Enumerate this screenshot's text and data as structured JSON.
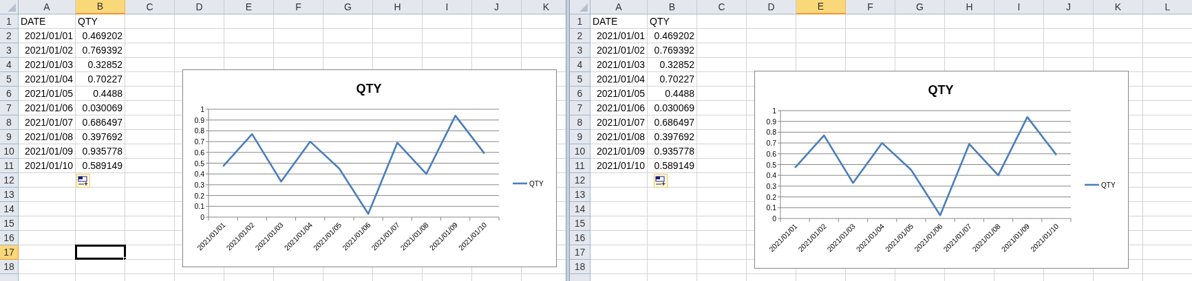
{
  "panes": [
    {
      "columns": [
        {
          "label": "A",
          "selected": false
        },
        {
          "label": "B",
          "selected": true
        },
        {
          "label": "C",
          "selected": false
        },
        {
          "label": "D",
          "selected": false
        },
        {
          "label": "E",
          "selected": false
        },
        {
          "label": "F",
          "selected": false
        },
        {
          "label": "G",
          "selected": false
        },
        {
          "label": "H",
          "selected": false
        },
        {
          "label": "I",
          "selected": false
        },
        {
          "label": "J",
          "selected": false
        },
        {
          "label": "K",
          "selected": false
        }
      ],
      "rows": [
        {
          "label": "1",
          "selected": false,
          "cells": [
            {
              "text": "DATE",
              "kind": "text"
            },
            {
              "text": "QTY",
              "kind": "text"
            }
          ]
        },
        {
          "label": "2",
          "selected": false,
          "cells": [
            {
              "text": "2021/01/01",
              "kind": "number"
            },
            {
              "text": "0.469202",
              "kind": "number"
            }
          ]
        },
        {
          "label": "3",
          "selected": false,
          "cells": [
            {
              "text": "2021/01/02",
              "kind": "number"
            },
            {
              "text": "0.769392",
              "kind": "number"
            }
          ]
        },
        {
          "label": "4",
          "selected": false,
          "cells": [
            {
              "text": "2021/01/03",
              "kind": "number"
            },
            {
              "text": "0.32852",
              "kind": "number"
            }
          ]
        },
        {
          "label": "5",
          "selected": false,
          "cells": [
            {
              "text": "2021/01/04",
              "kind": "number"
            },
            {
              "text": "0.70227",
              "kind": "number"
            }
          ]
        },
        {
          "label": "6",
          "selected": false,
          "cells": [
            {
              "text": "2021/01/05",
              "kind": "number"
            },
            {
              "text": "0.4488",
              "kind": "number"
            }
          ]
        },
        {
          "label": "7",
          "selected": false,
          "cells": [
            {
              "text": "2021/01/06",
              "kind": "number"
            },
            {
              "text": "0.030069",
              "kind": "number"
            }
          ]
        },
        {
          "label": "8",
          "selected": false,
          "cells": [
            {
              "text": "2021/01/07",
              "kind": "number"
            },
            {
              "text": "0.686497",
              "kind": "number"
            }
          ]
        },
        {
          "label": "9",
          "selected": false,
          "cells": [
            {
              "text": "2021/01/08",
              "kind": "number"
            },
            {
              "text": "0.397692",
              "kind": "number"
            }
          ]
        },
        {
          "label": "10",
          "selected": false,
          "cells": [
            {
              "text": "2021/01/09",
              "kind": "number"
            },
            {
              "text": "0.935778",
              "kind": "number"
            }
          ]
        },
        {
          "label": "11",
          "selected": false,
          "cells": [
            {
              "text": "2021/01/10",
              "kind": "number"
            },
            {
              "text": "0.589149",
              "kind": "number"
            }
          ]
        },
        {
          "label": "12",
          "selected": false,
          "cells": []
        },
        {
          "label": "13",
          "selected": false,
          "cells": []
        },
        {
          "label": "14",
          "selected": false,
          "cells": []
        },
        {
          "label": "15",
          "selected": false,
          "cells": []
        },
        {
          "label": "16",
          "selected": false,
          "cells": []
        },
        {
          "label": "17",
          "selected": true,
          "cells": []
        },
        {
          "label": "18",
          "selected": false,
          "cells": []
        }
      ],
      "chart": {
        "chart_data": {
          "type": "line",
          "title": "QTY",
          "categories": [
            "2021/01/01",
            "2021/01/02",
            "2021/01/03",
            "2021/01/04",
            "2021/01/05",
            "2021/01/06",
            "2021/01/07",
            "2021/01/08",
            "2021/01/09",
            "2021/01/10"
          ],
          "series": [
            {
              "name": "QTY",
              "color": "#4a7ebb",
              "values": [
                0.47,
                0.77,
                0.33,
                0.7,
                0.45,
                0.03,
                0.69,
                0.4,
                0.94,
                0.59
              ]
            }
          ],
          "ylim": [
            0,
            1
          ],
          "yticks": [
            0,
            0.1,
            0.2,
            0.3,
            0.4,
            0.5,
            0.6,
            0.7,
            0.8,
            0.9,
            1
          ],
          "grid": true
        }
      }
    },
    {
      "columns": [
        {
          "label": "A",
          "selected": false
        },
        {
          "label": "B",
          "selected": false
        },
        {
          "label": "C",
          "selected": false
        },
        {
          "label": "D",
          "selected": false
        },
        {
          "label": "E",
          "selected": true
        },
        {
          "label": "F",
          "selected": false
        },
        {
          "label": "G",
          "selected": false
        },
        {
          "label": "H",
          "selected": false
        },
        {
          "label": "I",
          "selected": false
        },
        {
          "label": "J",
          "selected": false
        },
        {
          "label": "K",
          "selected": false
        },
        {
          "label": "L",
          "selected": false
        }
      ],
      "rows": [
        {
          "label": "1",
          "selected": false,
          "cells": [
            {
              "text": "DATE",
              "kind": "text"
            },
            {
              "text": "QTY",
              "kind": "text"
            }
          ]
        },
        {
          "label": "2",
          "selected": false,
          "cells": [
            {
              "text": "2021/01/01",
              "kind": "number"
            },
            {
              "text": "0.469202",
              "kind": "number"
            }
          ]
        },
        {
          "label": "3",
          "selected": false,
          "cells": [
            {
              "text": "2021/01/02",
              "kind": "number"
            },
            {
              "text": "0.769392",
              "kind": "number"
            }
          ]
        },
        {
          "label": "4",
          "selected": false,
          "cells": [
            {
              "text": "2021/01/03",
              "kind": "number"
            },
            {
              "text": "0.32852",
              "kind": "number"
            }
          ]
        },
        {
          "label": "5",
          "selected": false,
          "cells": [
            {
              "text": "2021/01/04",
              "kind": "number"
            },
            {
              "text": "0.70227",
              "kind": "number"
            }
          ]
        },
        {
          "label": "6",
          "selected": false,
          "cells": [
            {
              "text": "2021/01/05",
              "kind": "number"
            },
            {
              "text": "0.4488",
              "kind": "number"
            }
          ]
        },
        {
          "label": "7",
          "selected": false,
          "cells": [
            {
              "text": "2021/01/06",
              "kind": "number"
            },
            {
              "text": "0.030069",
              "kind": "number"
            }
          ]
        },
        {
          "label": "8",
          "selected": false,
          "cells": [
            {
              "text": "2021/01/07",
              "kind": "number"
            },
            {
              "text": "0.686497",
              "kind": "number"
            }
          ]
        },
        {
          "label": "9",
          "selected": false,
          "cells": [
            {
              "text": "2021/01/08",
              "kind": "number"
            },
            {
              "text": "0.397692",
              "kind": "number"
            }
          ]
        },
        {
          "label": "10",
          "selected": false,
          "cells": [
            {
              "text": "2021/01/09",
              "kind": "number"
            },
            {
              "text": "0.935778",
              "kind": "number"
            }
          ]
        },
        {
          "label": "11",
          "selected": false,
          "cells": [
            {
              "text": "2021/01/10",
              "kind": "number"
            },
            {
              "text": "0.589149",
              "kind": "number"
            }
          ]
        },
        {
          "label": "12",
          "selected": false,
          "cells": []
        },
        {
          "label": "13",
          "selected": false,
          "cells": []
        },
        {
          "label": "14",
          "selected": false,
          "cells": []
        },
        {
          "label": "15",
          "selected": false,
          "cells": []
        },
        {
          "label": "16",
          "selected": false,
          "cells": []
        },
        {
          "label": "17",
          "selected": false,
          "cells": []
        },
        {
          "label": "18",
          "selected": false,
          "cells": []
        }
      ],
      "chart": {
        "chart_data": {
          "type": "line",
          "title": "QTY",
          "categories": [
            "2021/01/01",
            "2021/01/02",
            "2021/01/03",
            "2021/01/04",
            "2021/01/05",
            "2021/01/06",
            "2021/01/07",
            "2021/01/08",
            "2021/01/09",
            "2021/01/10"
          ],
          "series": [
            {
              "name": "QTY",
              "color": "#4a7ebb",
              "values": [
                0.47,
                0.77,
                0.33,
                0.7,
                0.45,
                0.03,
                0.69,
                0.4,
                0.94,
                0.59
              ]
            }
          ],
          "ylim": [
            0,
            1
          ],
          "yticks": [
            0,
            0.1,
            0.2,
            0.3,
            0.4,
            0.5,
            0.6,
            0.7,
            0.8,
            0.9,
            1
          ],
          "grid": true
        }
      }
    }
  ]
}
